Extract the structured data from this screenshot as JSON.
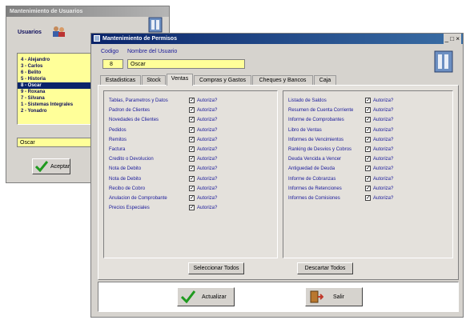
{
  "back_window": {
    "title": "Mantenimiento de Usuarios",
    "users_label": "Usuarios",
    "users": [
      "4 - Alejandro",
      "3 - Carlos",
      "6 - Belito",
      "5 - Historia",
      "8 - Oscar",
      "9 - Roxana",
      "7 - Silvana",
      "1 - Sistemas Integrales",
      "2 - Yonadro"
    ],
    "selected_user_index": 4,
    "selected_user_name": "Oscar",
    "accept_label": "Aceptar"
  },
  "front_window": {
    "title": "Mantenimiento de Permisos",
    "codigo_label": "Codigo",
    "nombre_label": "Nombre del Usuario",
    "codigo_value": "8",
    "nombre_value": "Oscar",
    "tabs": [
      "Estadisticas",
      "Stock",
      "Ventas",
      "Compras y Gastos",
      "Cheques y Bancos",
      "Caja"
    ],
    "active_tab_index": 2,
    "allow_label": "Autoriza?",
    "left_permissions": [
      "Tablas, Parametros y Datos",
      "Padron de Clientes",
      "Novedades de Clientes",
      "Pedidos",
      "Remitos",
      "Factura",
      "Credito o Devolucion",
      "Nota de Debito",
      "Nota de Debito",
      "Recibo de Cobro",
      "Anulacion de Comprobante",
      "Precios Especiales"
    ],
    "right_permissions": [
      "Listado de Saldos",
      "Resumen de Cuenta Corriente",
      "Informe de Comprobantes",
      "Libro de Ventas",
      "Informes de Vencimientos",
      "Ranking de Desvios y Cobros",
      "Deuda Vencida a Vencer",
      "Antiguedad de Deuda",
      "Informe de Cobranzas",
      "Informes de Retenciones",
      "Informes de Comisiones"
    ],
    "select_all_label": "Seleccionar Todos",
    "deselect_all_label": "Descartar Todos",
    "update_label": "Actualizar",
    "exit_label": "Salir"
  },
  "colors": {
    "title_active": "#0a246a",
    "field_bg": "#ffff99",
    "label": "#1a1a9a",
    "panel": "#d6d3ce"
  }
}
